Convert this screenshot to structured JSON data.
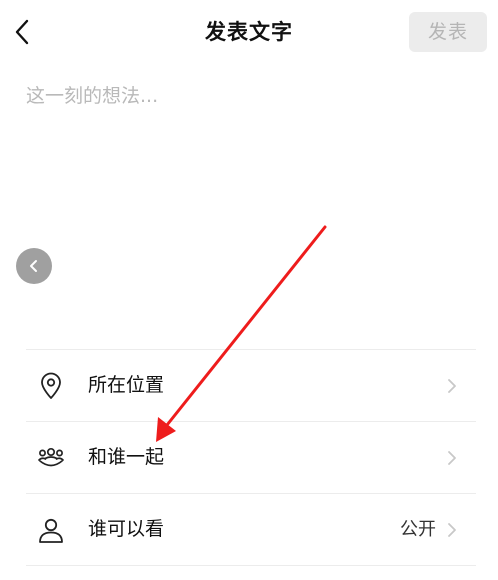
{
  "header": {
    "title": "发表文字",
    "publish_label": "发表"
  },
  "editor": {
    "placeholder": "这一刻的想法..."
  },
  "options": [
    {
      "label": "所在位置",
      "value": "",
      "icon": "location-pin-icon"
    },
    {
      "label": "和谁一起",
      "value": "",
      "icon": "people-together-icon"
    },
    {
      "label": "谁可以看",
      "value": "公开",
      "icon": "person-icon"
    }
  ],
  "colors": {
    "publish_bg": "#ececec",
    "publish_text": "#b5b5b5",
    "placeholder": "#b9b9b9",
    "annotation_arrow": "#ee1c1c",
    "collapse_button": "#a0a0a0"
  }
}
